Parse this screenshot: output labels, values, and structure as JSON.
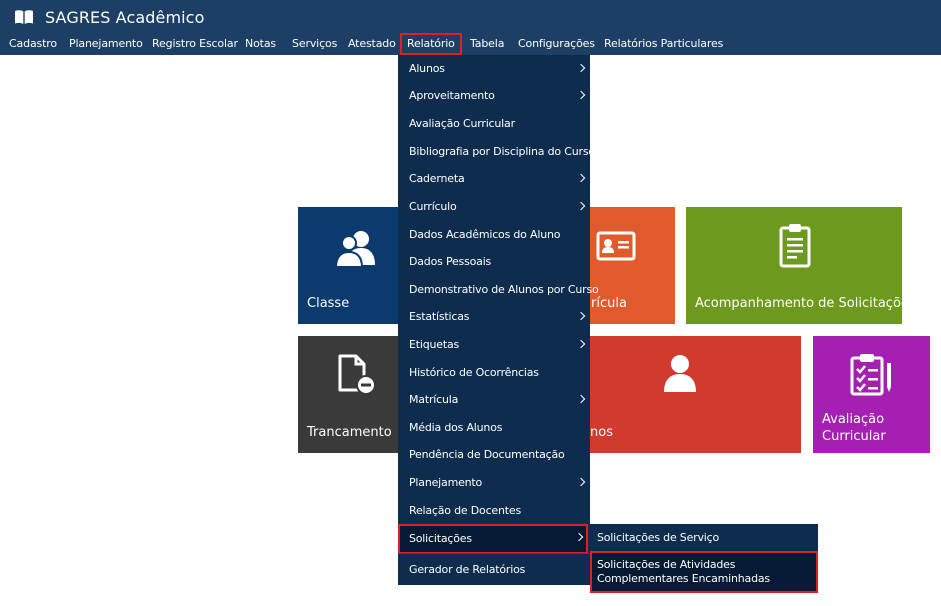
{
  "app": {
    "title": "SAGRES Acadêmico",
    "brand_icon": "book-icon"
  },
  "nav": {
    "items": [
      {
        "label": "Cadastro"
      },
      {
        "label": "Planejamento"
      },
      {
        "label": "Registro Escolar"
      },
      {
        "label": "Notas"
      },
      {
        "label": "Serviços"
      },
      {
        "label": "Atestado"
      },
      {
        "label": "Relatório",
        "active": true
      },
      {
        "label": "Tabela"
      },
      {
        "label": "Configurações"
      },
      {
        "label": "Relatórios Particulares"
      }
    ]
  },
  "dropdown": {
    "items": [
      {
        "label": "Alunos",
        "has_submenu": true
      },
      {
        "label": "Aproveitamento",
        "has_submenu": true
      },
      {
        "label": "Avaliação Curricular",
        "has_submenu": false
      },
      {
        "label": "Bibliografia por Disciplina do Curso",
        "has_submenu": false
      },
      {
        "label": "Caderneta",
        "has_submenu": true
      },
      {
        "label": "Currículo",
        "has_submenu": true
      },
      {
        "label": "Dados Acadêmicos do Aluno",
        "has_submenu": false
      },
      {
        "label": "Dados Pessoais",
        "has_submenu": false
      },
      {
        "label": "Demonstrativo de Alunos por Curso",
        "has_submenu": false
      },
      {
        "label": "Estatísticas",
        "has_submenu": true
      },
      {
        "label": "Etiquetas",
        "has_submenu": true
      },
      {
        "label": "Histórico de Ocorrências",
        "has_submenu": false
      },
      {
        "label": "Matrícula",
        "has_submenu": true
      },
      {
        "label": "Média dos Alunos",
        "has_submenu": false
      },
      {
        "label": "Pendência de Documentação",
        "has_submenu": false
      },
      {
        "label": "Planejamento",
        "has_submenu": true
      },
      {
        "label": "Relação de Docentes",
        "has_submenu": false
      },
      {
        "label": "Solicitações",
        "has_submenu": true,
        "highlighted": true
      },
      {
        "label": "Gerador de Relatórios",
        "has_submenu": false
      }
    ]
  },
  "submenu": {
    "items": [
      {
        "label": "Solicitações de Serviço"
      },
      {
        "label": "Solicitações de Atividades Complementares Encaminhadas",
        "highlighted": true
      }
    ]
  },
  "tiles": [
    {
      "label": "Classe",
      "color": "#0b3a6e",
      "icon": "users-icon"
    },
    {
      "label": "rícula",
      "color": "#e05a2b",
      "icon": "id-card-icon"
    },
    {
      "label": "Acompanhamento de Solicitações",
      "color": "#6b9a1e",
      "icon": "clipboard-icon"
    },
    {
      "label": "Trancamento",
      "color": "#3a3a3a",
      "icon": "file-remove-icon"
    },
    {
      "label": "nos",
      "color": "#d13a2f",
      "icon": "user-icon"
    },
    {
      "label": "Avaliação\nCurricular",
      "label_line1": "Avaliação",
      "label_line2": "Curricular",
      "color": "#a51fb3",
      "icon": "checklist-icon"
    }
  ]
}
